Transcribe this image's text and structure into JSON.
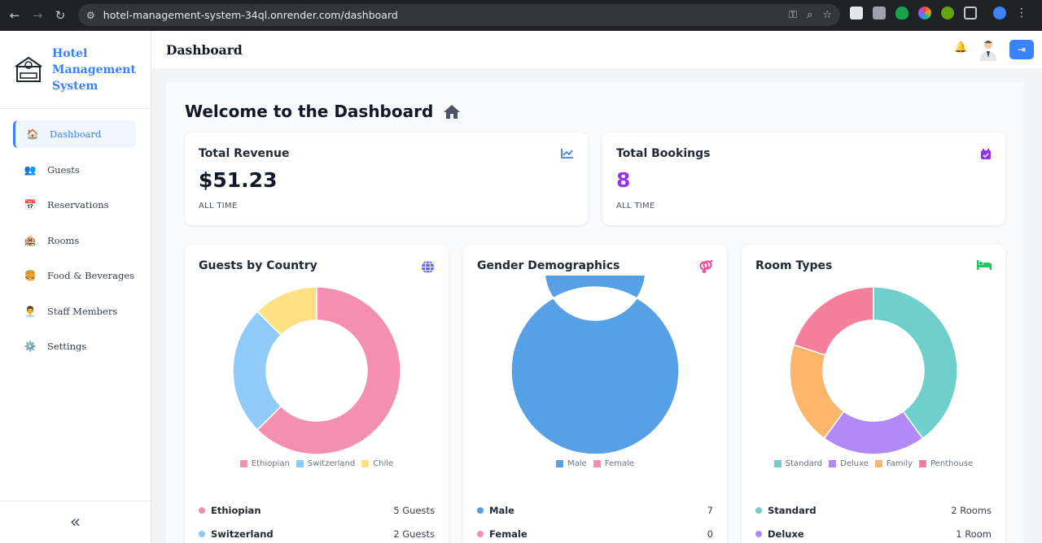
{
  "browser": {
    "url": "hotel-management-system-34ql.onrender.com/dashboard"
  },
  "sidebar": {
    "brand": [
      "Hotel",
      "Management",
      "System"
    ],
    "items": [
      {
        "label": "Dashboard",
        "icon": "home-icon",
        "glyph": "🏠",
        "active": true
      },
      {
        "label": "Guests",
        "icon": "guests-icon",
        "glyph": "👥",
        "active": false
      },
      {
        "label": "Reservations",
        "icon": "calendar-icon",
        "glyph": "📅",
        "active": false
      },
      {
        "label": "Rooms",
        "icon": "hotel-icon",
        "glyph": "🏨",
        "active": false
      },
      {
        "label": "Food & Beverages",
        "icon": "burger-icon",
        "glyph": "🍔",
        "active": false
      },
      {
        "label": "Staff Members",
        "icon": "staff-icon",
        "glyph": "👨‍💼",
        "active": false
      },
      {
        "label": "Settings",
        "icon": "gear-icon",
        "glyph": "⚙️",
        "active": false
      }
    ],
    "collapse_glyph": "«"
  },
  "header": {
    "title": "Dashboard"
  },
  "main": {
    "welcome": "Welcome to the Dashboard",
    "stats": [
      {
        "title": "Total Revenue",
        "value": "$51.23",
        "sub": "ALL TIME",
        "icon": "chart-line-icon",
        "color": "#3b82f6",
        "value_color": "#111827"
      },
      {
        "title": "Total Bookings",
        "value": "8",
        "sub": "ALL TIME",
        "icon": "calendar-check-icon",
        "color": "#9333ea",
        "value_color": "#9333ea"
      }
    ]
  },
  "chart_data": [
    {
      "type": "pie",
      "title": "Guests by Country",
      "categories": [
        "Ethiopian",
        "Switzerland",
        "Chile"
      ],
      "values": [
        5,
        2,
        1
      ],
      "colors": [
        "#f48fb1",
        "#90caf9",
        "#ffe082"
      ],
      "legend": "bottom",
      "list": [
        {
          "name": "Ethiopian",
          "value": "5 Guests",
          "color": "#f48fb1"
        },
        {
          "name": "Switzerland",
          "value": "2 Guests",
          "color": "#90caf9"
        }
      ]
    },
    {
      "type": "pie",
      "title": "Gender Demographics",
      "categories": [
        "Male",
        "Female"
      ],
      "values": [
        7,
        0
      ],
      "colors": [
        "#57a0e5",
        "#f48fb1"
      ],
      "legend": "bottom",
      "list": [
        {
          "name": "Male",
          "value": "7",
          "color": "#57a0e5"
        },
        {
          "name": "Female",
          "value": "0",
          "color": "#f48fb1"
        }
      ]
    },
    {
      "type": "pie",
      "title": "Room Types",
      "categories": [
        "Standard",
        "Deluxe",
        "Family",
        "Penthouse"
      ],
      "values": [
        2,
        1,
        1,
        1
      ],
      "colors": [
        "#6ecfcb",
        "#b18af5",
        "#fdb46b",
        "#f67f9b"
      ],
      "legend": "bottom",
      "list": [
        {
          "name": "Standard",
          "value": "2 Rooms",
          "color": "#6ecfcb"
        },
        {
          "name": "Deluxe",
          "value": "1 Room",
          "color": "#b18af5"
        }
      ]
    }
  ]
}
